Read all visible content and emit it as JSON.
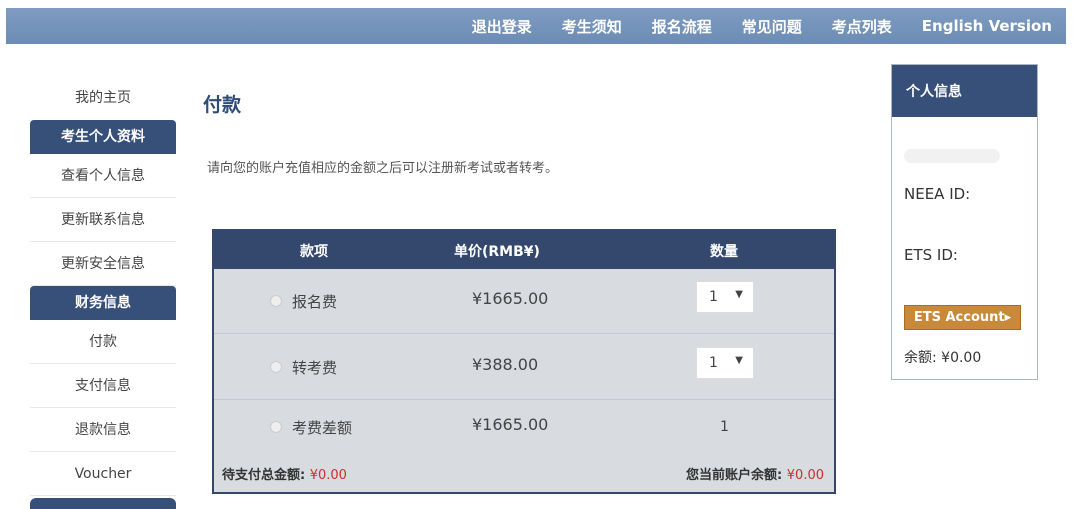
{
  "nav": {
    "items": [
      "退出登录",
      "考生须知",
      "报名流程",
      "常见问题",
      "考点列表",
      "English Version"
    ]
  },
  "sidebar": {
    "home": "我的主页",
    "section1_title": "考生个人资料",
    "section1_items": [
      "查看个人信息",
      "更新联系信息",
      "更新安全信息"
    ],
    "section2_title": "财务信息",
    "section2_items": [
      "付款",
      "支付信息",
      "退款信息",
      "Voucher"
    ]
  },
  "main": {
    "title": "付款",
    "intro": "请向您的账户充值相应的金额之后可以注册新考试或者转考。"
  },
  "table": {
    "headers": [
      "款项",
      "单价(RMB¥)",
      "数量"
    ],
    "rows": [
      {
        "name": "报名费",
        "price": "¥1665.00",
        "qty": "1"
      },
      {
        "name": "转考费",
        "price": "¥388.00",
        "qty": "1"
      },
      {
        "name": "考费差额",
        "price": "¥1665.00",
        "qty": "1"
      }
    ],
    "total_label": "待支付总金额:",
    "total_value": "¥0.00",
    "balance_label": "您当前账户余额:",
    "balance_value": "¥0.00"
  },
  "profile": {
    "title": "个人信息",
    "neea_label": "NEEA ID:",
    "ets_label": "ETS ID:",
    "ets_button": "ETS Account▸",
    "balance": "余额: ¥0.00"
  },
  "colors": {
    "nav_bg": "#7392ba",
    "header_dark": "#36507a",
    "ets_button": "#c88a3a",
    "amount_red": "#c9302c"
  }
}
